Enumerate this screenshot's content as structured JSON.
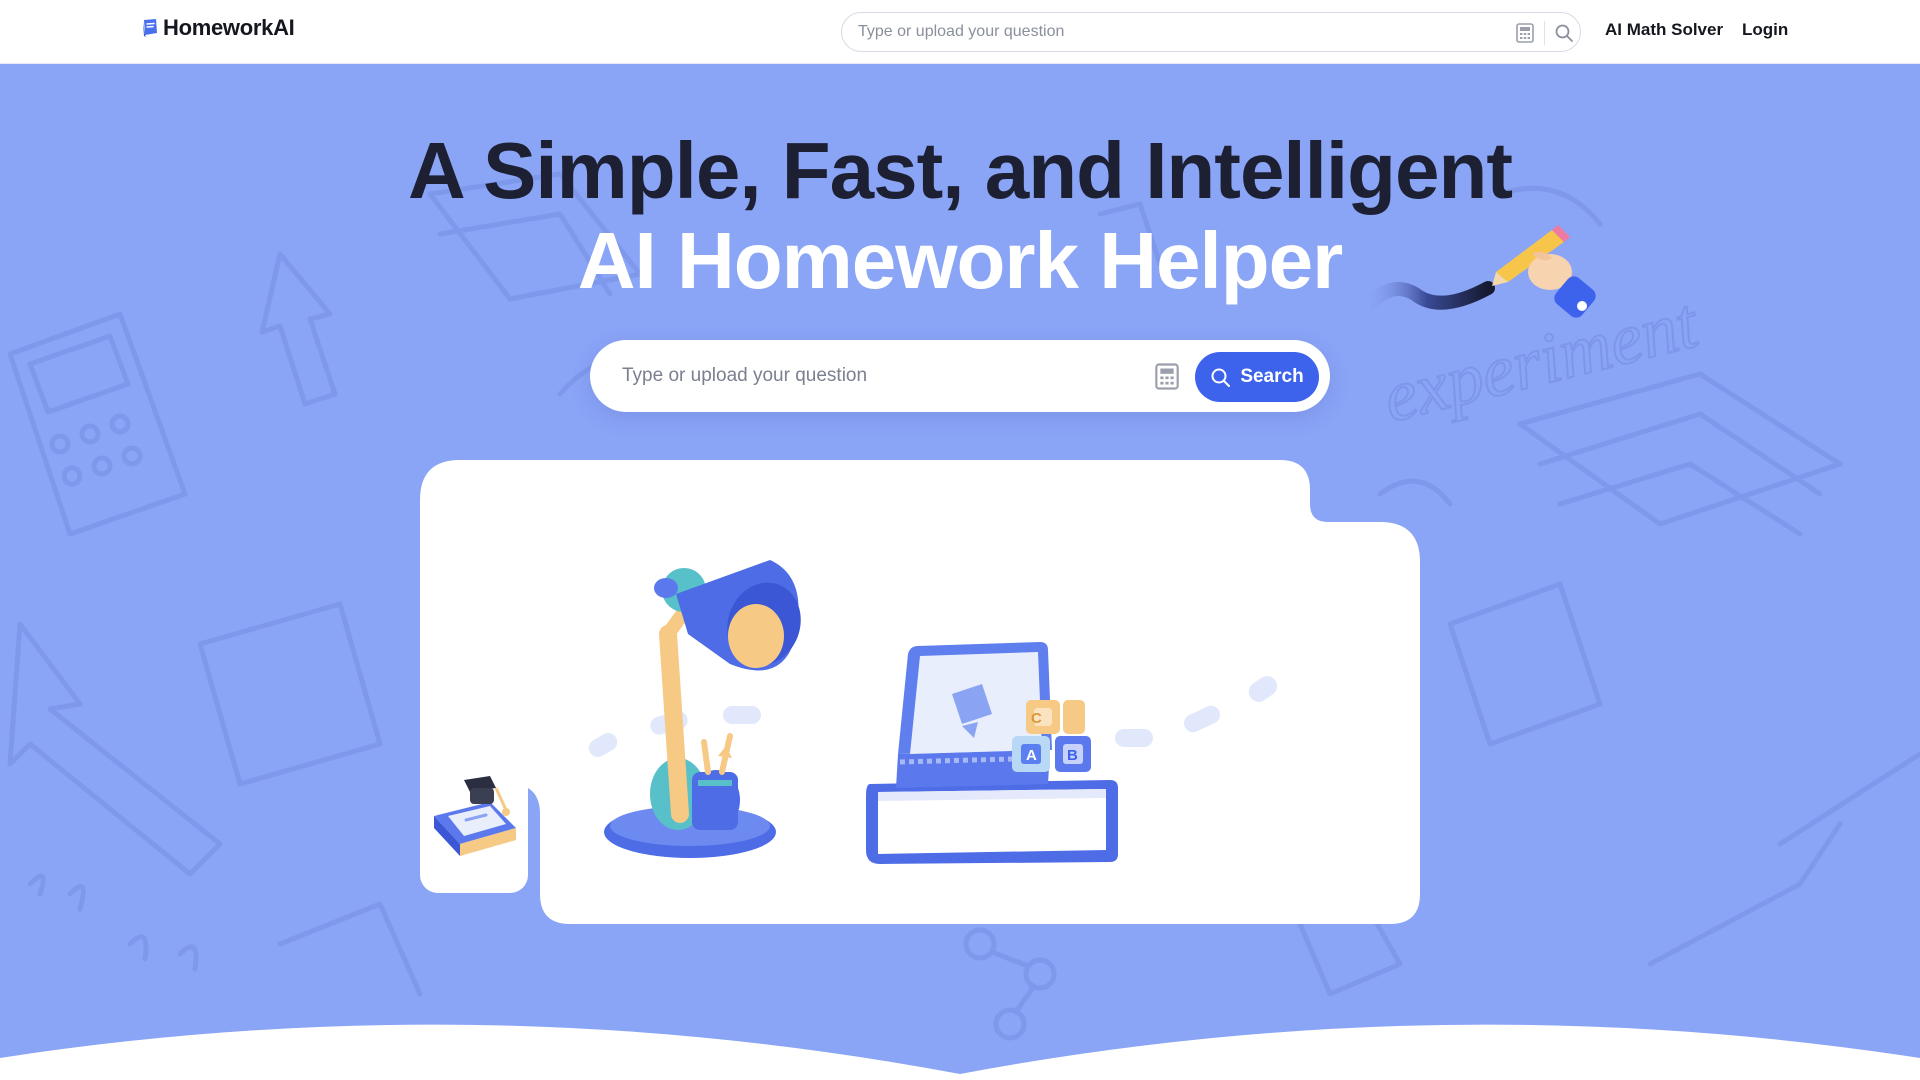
{
  "app": {
    "name": "HomeworkAI"
  },
  "nav": {
    "search_placeholder": "Type or upload your question",
    "links": {
      "math_solver": "AI Math Solver",
      "login": "Login"
    },
    "icons": {
      "logo": "book-icon",
      "calculator": "calculator-icon",
      "search": "search-icon"
    }
  },
  "hero": {
    "title_line1": "A Simple, Fast, and Intelligent",
    "title_line2": "AI Homework Helper",
    "search_placeholder": "Type or upload your question",
    "search_button": "Search",
    "decoration_text": "experiment"
  },
  "colors": {
    "hero_bg": "#8aa4f6",
    "accent": "#3d63ec",
    "title_dark": "#1d2033",
    "title_light": "#ffffff"
  }
}
